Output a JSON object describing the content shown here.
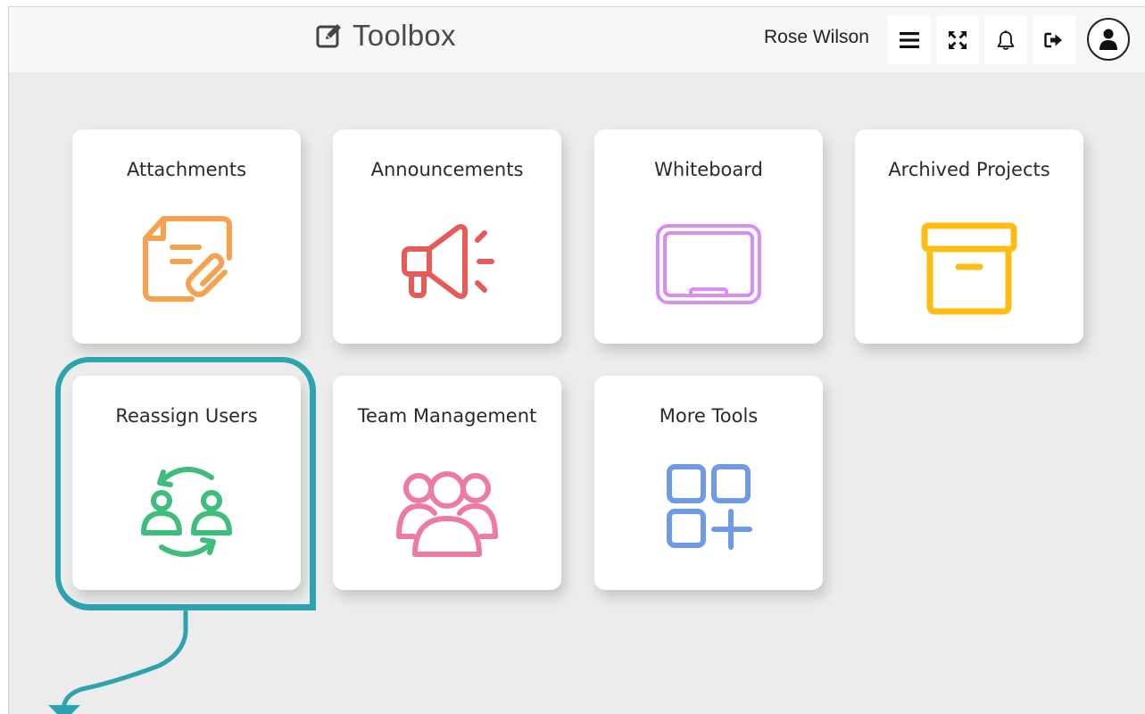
{
  "header": {
    "title": "Toolbox",
    "title_icon": "edit-icon",
    "user_name": "Rose Wilson",
    "buttons": [
      {
        "name": "menu-button",
        "icon": "hamburger-menu-icon"
      },
      {
        "name": "fullscreen-button",
        "icon": "expand-arrows-icon"
      },
      {
        "name": "notifications-button",
        "icon": "bell-icon"
      },
      {
        "name": "logout-button",
        "icon": "sign-out-icon"
      }
    ],
    "avatar_icon": "user-icon"
  },
  "tiles": [
    {
      "label": "Attachments",
      "icon": "document-paperclip-icon",
      "color": "#f7a14f"
    },
    {
      "label": "Announcements",
      "icon": "megaphone-icon",
      "color": "#e65a5a"
    },
    {
      "label": "Whiteboard",
      "icon": "whiteboard-icon",
      "color": "#d98cf2"
    },
    {
      "label": "Archived Projects",
      "icon": "archive-box-icon",
      "color": "#ffbd14"
    },
    {
      "label": "Reassign Users",
      "icon": "users-swap-icon",
      "color": "#3ebd7d"
    },
    {
      "label": "Team Management",
      "icon": "team-group-icon",
      "color": "#ec7aa4"
    },
    {
      "label": "More Tools",
      "icon": "grid-plus-icon",
      "color": "#6f9be6"
    }
  ],
  "annotation": {
    "highlight_color": "#2ea3b0",
    "highlighted_tile": "Reassign Users"
  }
}
